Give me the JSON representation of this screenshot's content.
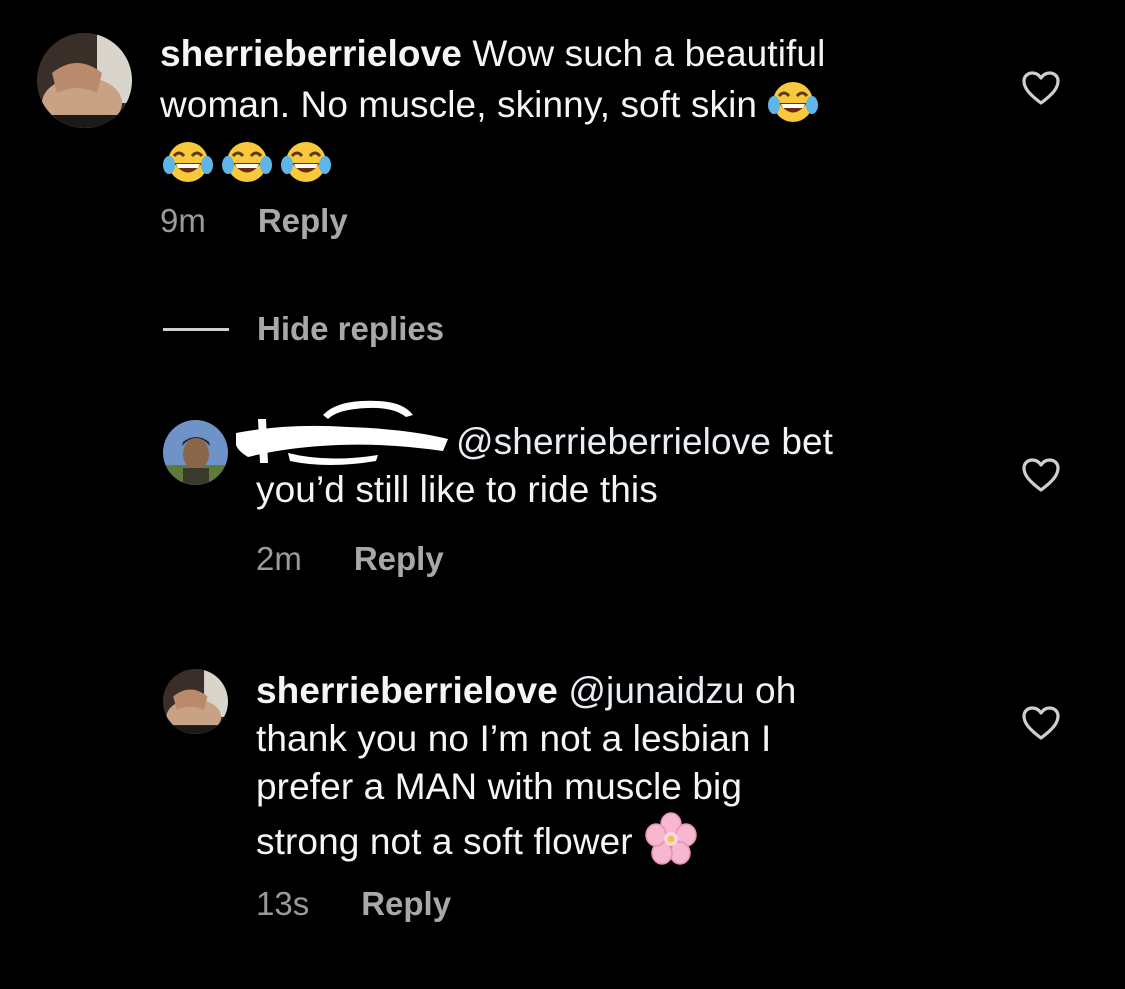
{
  "comments": [
    {
      "username": "sherrieberrielove",
      "text_line1": "Wow such a beautiful",
      "text_line2": "woman. No muscle, skinny, soft skin",
      "emoji": "face-with-tears-of-joy",
      "time": "9m",
      "reply_label": "Reply"
    }
  ],
  "hide_replies_label": "Hide replies",
  "replies": [
    {
      "username_redacted": true,
      "mention": "@sherrieberrielove",
      "text_line1_rest": " bet",
      "text_line2": "you’d still like to ride this",
      "time": "2m",
      "reply_label": "Reply"
    },
    {
      "username": "sherrieberrielove",
      "mention": "@junaidzu",
      "text_line1_rest": " oh",
      "text_line2": "thank you no I’m not a lesbian I",
      "text_line3": "prefer a MAN with muscle big",
      "text_line4": "strong not a soft flower",
      "emoji": "cherry-blossom",
      "time": "13s",
      "reply_label": "Reply"
    }
  ],
  "colors": {
    "background": "#000000",
    "text": "#f5f5f5",
    "meta": "#9a9a9a"
  }
}
